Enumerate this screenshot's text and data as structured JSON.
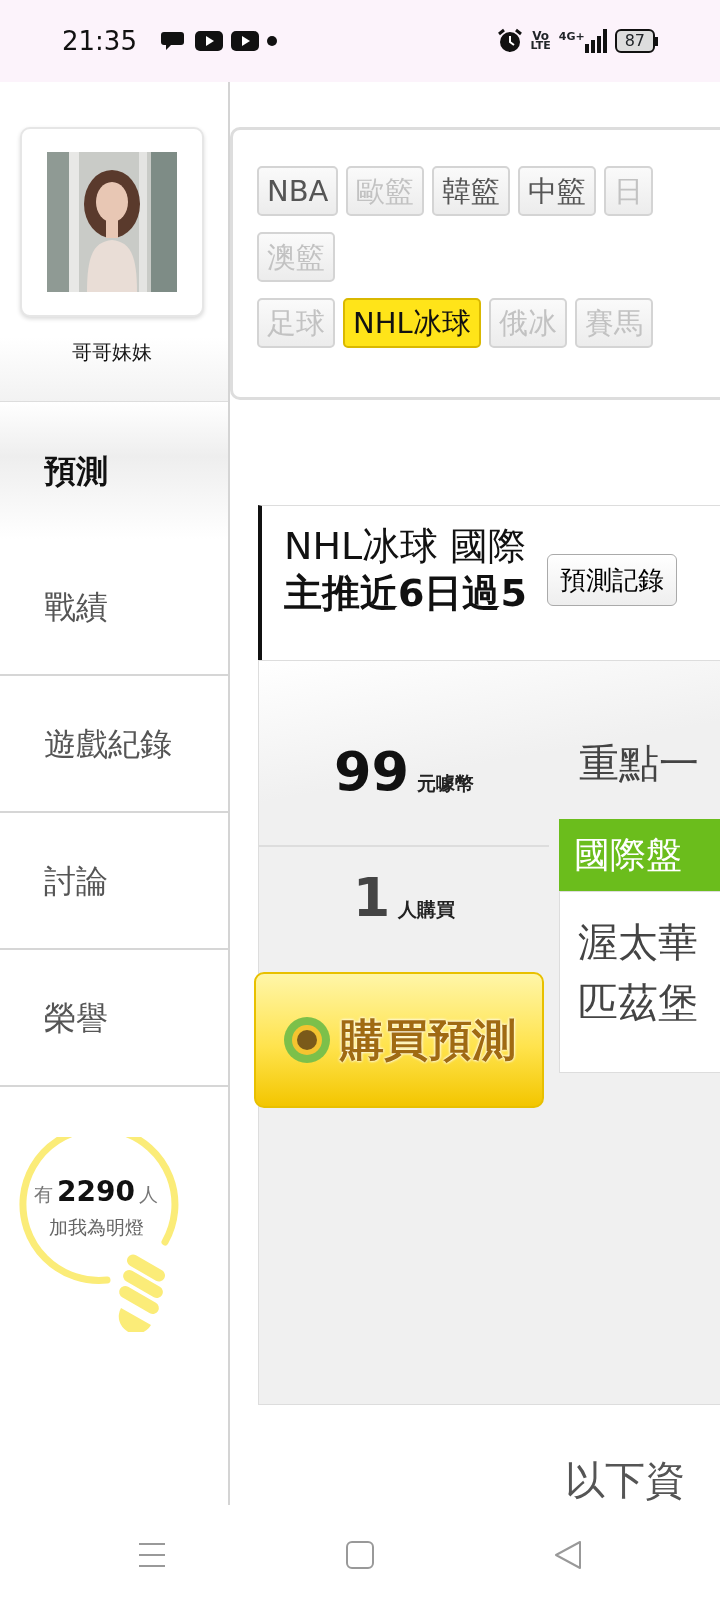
{
  "status_bar": {
    "time": "21:35",
    "volte_top": "Vo",
    "volte_bottom": "LTE",
    "network": "4G+",
    "battery": "87"
  },
  "profile": {
    "name": "哥哥妹妹"
  },
  "menu": [
    {
      "label": "預測",
      "selected": true
    },
    {
      "label": "戰績",
      "selected": false
    },
    {
      "label": "遊戲紀錄",
      "selected": false
    },
    {
      "label": "討論",
      "selected": false
    },
    {
      "label": "榮譽",
      "selected": false
    }
  ],
  "fans": {
    "prefix": "有",
    "count": "2290",
    "suffix": "人",
    "caption": "加我為明燈"
  },
  "tag_rows": [
    [
      {
        "label": "NBA",
        "selected": false,
        "disabled": false
      },
      {
        "label": "歐籃",
        "selected": false,
        "disabled": true
      },
      {
        "label": "韓籃",
        "selected": false,
        "disabled": false
      },
      {
        "label": "中籃",
        "selected": false,
        "disabled": false
      },
      {
        "label": "日",
        "selected": false,
        "disabled": true
      }
    ],
    [
      {
        "label": "澳籃",
        "selected": false,
        "disabled": true
      }
    ],
    [
      {
        "label": "足球",
        "selected": false,
        "disabled": true
      },
      {
        "label": "NHL冰球",
        "selected": true,
        "disabled": false
      },
      {
        "label": "俄冰",
        "selected": false,
        "disabled": true
      },
      {
        "label": "賽馬",
        "selected": false,
        "disabled": true
      }
    ]
  ],
  "header": {
    "title": "NHL冰球 國際",
    "subtitle": "主推近6日過5",
    "record_button": "預測記錄"
  },
  "offer": {
    "price": "99",
    "price_unit": "元噱幣",
    "buyers": "1",
    "buyers_unit": "人購買",
    "buy_button": "購買預測"
  },
  "pick": {
    "heading": "重點一",
    "market": "國際盤",
    "teams": [
      "渥太華",
      "匹茲堡"
    ]
  },
  "footer_text": "以下資"
}
